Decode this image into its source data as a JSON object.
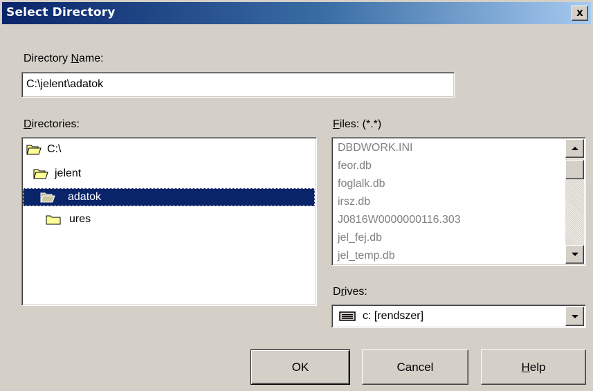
{
  "window": {
    "title": "Select Directory",
    "close_label": "x"
  },
  "directory_name": {
    "label_pre": "Directory ",
    "label_key": "N",
    "label_post": "ame:",
    "value": "C:\\jelent\\adatok"
  },
  "directories": {
    "label_key": "D",
    "label_post": "irectories:",
    "items": [
      {
        "label": "C:\\",
        "state": "open"
      },
      {
        "label": "jelent",
        "state": "open"
      },
      {
        "label": "adatok",
        "state": "open",
        "selected": true
      },
      {
        "label": "ures",
        "state": "closed"
      }
    ]
  },
  "files": {
    "label_key": "F",
    "label_post": "iles: (*.*)",
    "items": [
      "DBDWORK.INI",
      "feor.db",
      "foglalk.db",
      "irsz.db",
      "J0816W0000000116.303",
      "jel_fej.db",
      "jel_temp.db"
    ]
  },
  "drives": {
    "label_pre": "D",
    "label_key": "r",
    "label_post": "ives:",
    "selected": "c: [rendszer]",
    "icon": "drive-icon"
  },
  "buttons": {
    "ok": "OK",
    "cancel": "Cancel",
    "help_key": "H",
    "help_post": "elp"
  },
  "colors": {
    "title_gradient_start": "#0a246a",
    "title_gradient_end": "#a6caf0",
    "face": "#d4d0c8",
    "selection": "#0a246a",
    "folder": "#ffff99"
  }
}
